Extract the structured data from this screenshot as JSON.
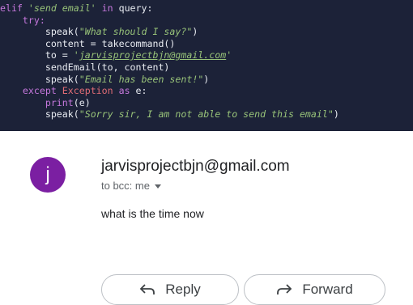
{
  "code": {
    "lines": [
      [
        "kw:elif ",
        "str:'send email'",
        "kw: in ",
        "txt:query:"
      ],
      [
        "txt:    ",
        "kw:try:"
      ],
      [
        "txt:        speak(",
        "str:\"What should I say?\"",
        "txt:)"
      ],
      [
        "txt:        content = takecommand()"
      ],
      [
        "txt:        to = ",
        "str:'",
        "strul:jarvisprojectbjn@gmail.com",
        "str:'"
      ],
      [
        "txt:        sendEmail(to, content)"
      ],
      [
        "txt:        speak(",
        "str:\"Email has been sent!\"",
        "txt:)"
      ],
      [
        "txt:    ",
        "kw:except ",
        "err:Exception",
        "kw: as ",
        "txt:e:"
      ],
      [
        "txt:        ",
        "pr:print",
        "txt:(e)"
      ],
      [
        "txt:        speak(",
        "str:\"Sorry sir, I am not able to send this email\"",
        "txt:)"
      ]
    ]
  },
  "email": {
    "avatar_letter": "j",
    "sender": "jarvisprojectbjn@gmail.com",
    "recipient": "to bcc: me",
    "body": "what is the time now",
    "reply_label": "Reply",
    "forward_label": "Forward"
  },
  "colors": {
    "code_bg": "#1c2238",
    "avatar": "#7b1fa2"
  }
}
